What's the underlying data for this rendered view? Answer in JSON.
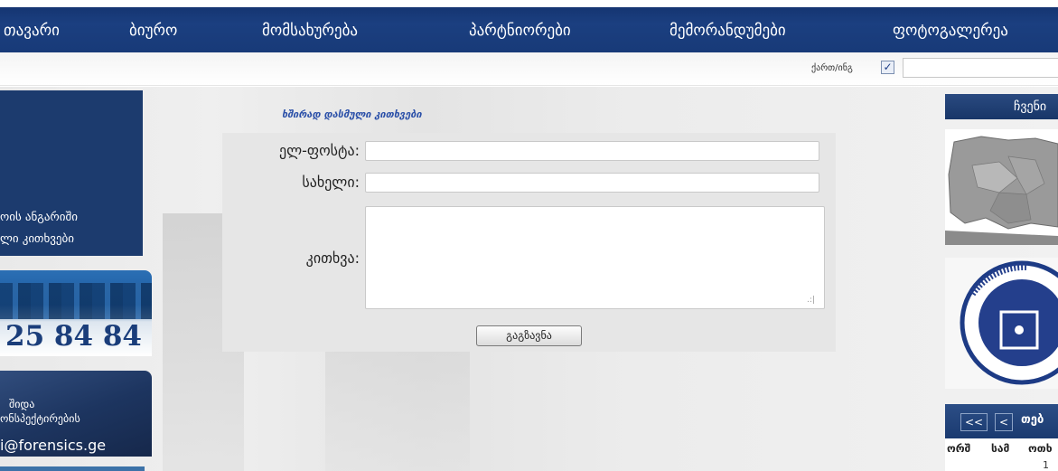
{
  "nav": {
    "items": [
      "თავარი",
      "ბიურო",
      "მომსახურება",
      "პარტნიორები",
      "მემორანდუმები",
      "ფოტოგალერეა"
    ]
  },
  "subbar": {
    "keyboard_label": "ქართ/ინგ",
    "keyboard_checked": "✓"
  },
  "left": {
    "link1": "ოის ანგარიში",
    "link2": "ლი კითხვები",
    "phone": "25 84 84",
    "banner_line1": "შიდა",
    "banner_line2": "ონსპექტირების",
    "email": "i@forensics.ge"
  },
  "form": {
    "faq_link": "ხშირად დასმული კითხვები",
    "email_label": "ელ-ფოსტა:",
    "name_label": "სახელი:",
    "question_label": "კითხვა:",
    "submit_label": "გაგზავნა",
    "email_value": "",
    "name_value": ""
  },
  "right": {
    "header": "ჩვენი",
    "calendar": {
      "prev2": "<<",
      "prev": "<",
      "month": "თებ",
      "days": [
        "ორშ",
        "სამ",
        "ოთხ"
      ],
      "first_date": "1"
    }
  },
  "colors": {
    "nav_bg": "#1b3f80",
    "left_panel": "#1c3b6e",
    "form_bg": "#e6e6e6",
    "link": "#2a4fa8"
  }
}
